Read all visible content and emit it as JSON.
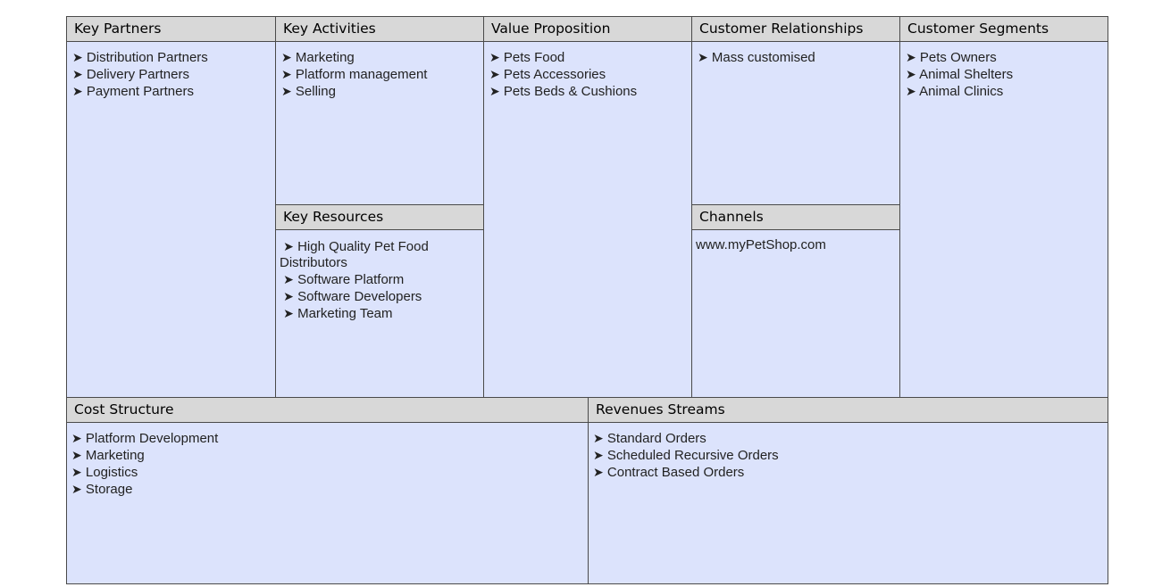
{
  "bullet_glyph": "➤",
  "colors": {
    "cell_fill": "#dce3fc",
    "header_fill": "#d8d8d8",
    "border": "#4a4a4a"
  },
  "key_partners": {
    "title": "Key Partners",
    "items": [
      "Distribution Partners",
      "Delivery Partners",
      "Payment Partners"
    ]
  },
  "key_activities": {
    "title": "Key Activities",
    "items": [
      "Marketing",
      "Platform management",
      "Selling"
    ]
  },
  "key_resources": {
    "title": "Key Resources",
    "items": [
      "High Quality Pet Food Distributors",
      "Software Platform",
      "Software Developers",
      "Marketing Team"
    ]
  },
  "value_proposition": {
    "title": "Value Proposition",
    "items": [
      "Pets Food",
      "Pets Accessories",
      "Pets Beds & Cushions"
    ]
  },
  "customer_relationships": {
    "title": "Customer Relationships",
    "items": [
      "Mass customised"
    ]
  },
  "channels": {
    "title": "Channels",
    "text": "www.myPetShop.com"
  },
  "customer_segments": {
    "title": "Customer Segments",
    "items": [
      "Pets Owners",
      "Animal Shelters",
      "Animal Clinics"
    ]
  },
  "cost_structure": {
    "title": "Cost Structure",
    "items": [
      "Platform Development",
      "Marketing",
      "Logistics",
      "Storage"
    ]
  },
  "revenue_streams": {
    "title": "Revenues Streams",
    "items": [
      "Standard Orders",
      "Scheduled Recursive Orders",
      "Contract Based Orders"
    ]
  }
}
